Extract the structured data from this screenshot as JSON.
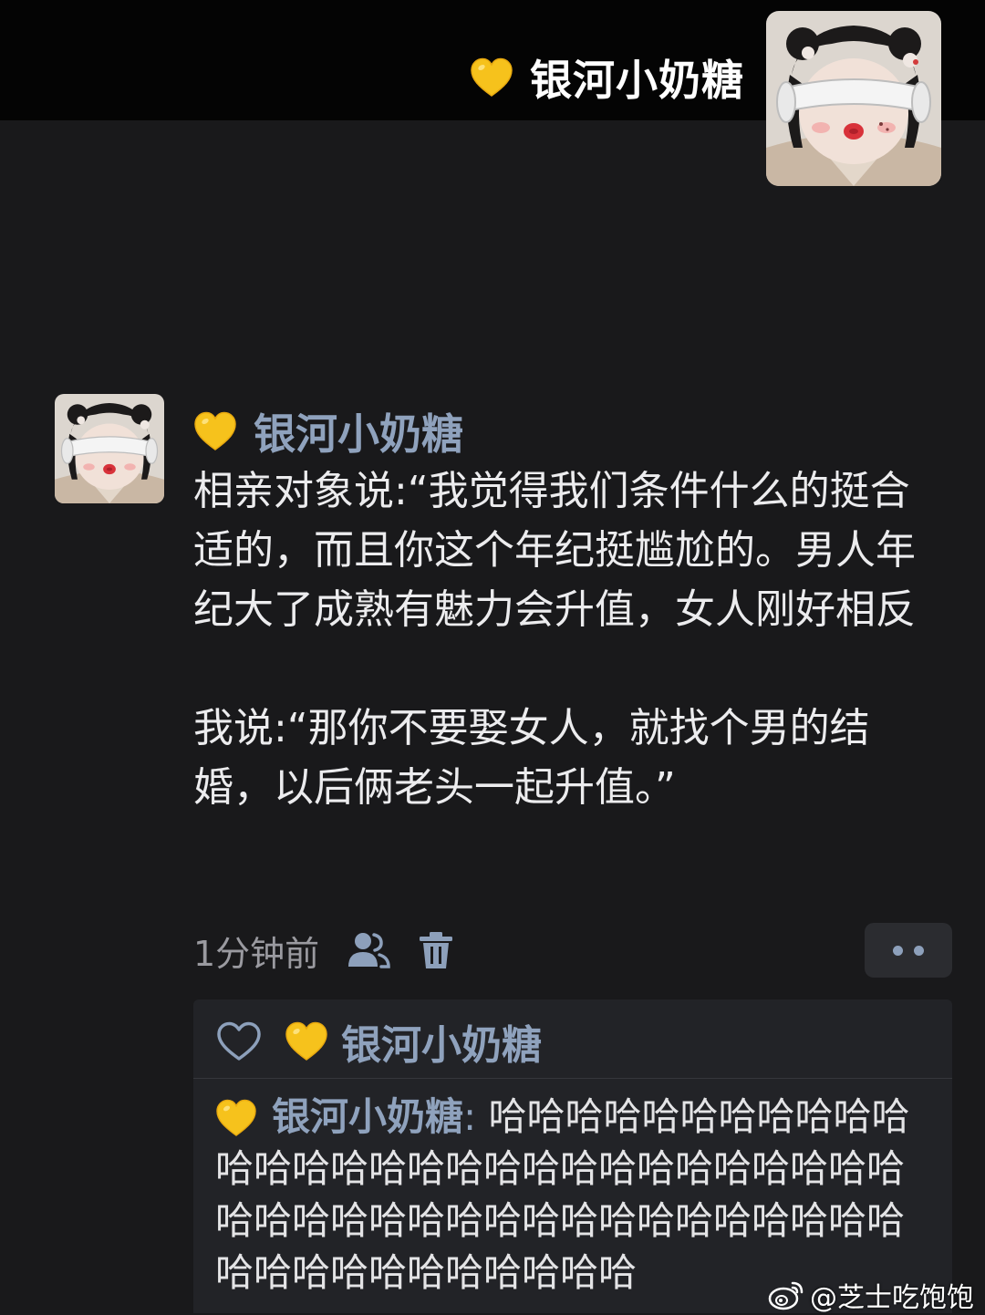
{
  "header": {
    "badge_icon": "yellow-heart-icon",
    "username": "银河小奶糖"
  },
  "post": {
    "author_badge_icon": "yellow-heart-icon",
    "author": "银河小奶糖",
    "paragraphs": [
      "相亲对象说:“我觉得我们条件什么的挺合适的，而且你这个年纪挺尴尬的。男人年纪大了成熟有魅力会升值，女人刚好相反",
      "我说:“那你不要娶女人，就找个男的结婚，以后俩老头一起升值。”"
    ],
    "time": "1分钟前",
    "icons": [
      "people-icon",
      "trash-icon",
      "more-icon"
    ]
  },
  "likes": {
    "icon": "heart-outline-icon",
    "users": [
      {
        "badge_icon": "yellow-heart-icon",
        "name": "银河小奶糖"
      }
    ]
  },
  "comments": [
    {
      "badge_icon": "yellow-heart-icon",
      "author": "银河小奶糖",
      "separator": ":",
      "text": " 哈哈哈哈哈哈哈哈哈哈哈哈哈哈哈哈哈哈哈哈哈哈哈哈哈哈哈哈哈哈哈哈哈哈哈哈哈哈哈哈哈哈哈哈哈哈哈哈哈哈哈哈哈哈哈哈哈哈"
    }
  ],
  "watermark": {
    "logo_icon": "weibo-logo-icon",
    "text": "@芝士吃饱饱"
  },
  "colors": {
    "background": "#19191b",
    "header_background": "#040404",
    "username_link": "#8fa2bd",
    "body_text": "#ececee",
    "muted_text": "#9a9aa0",
    "panel_background": "#222327"
  }
}
